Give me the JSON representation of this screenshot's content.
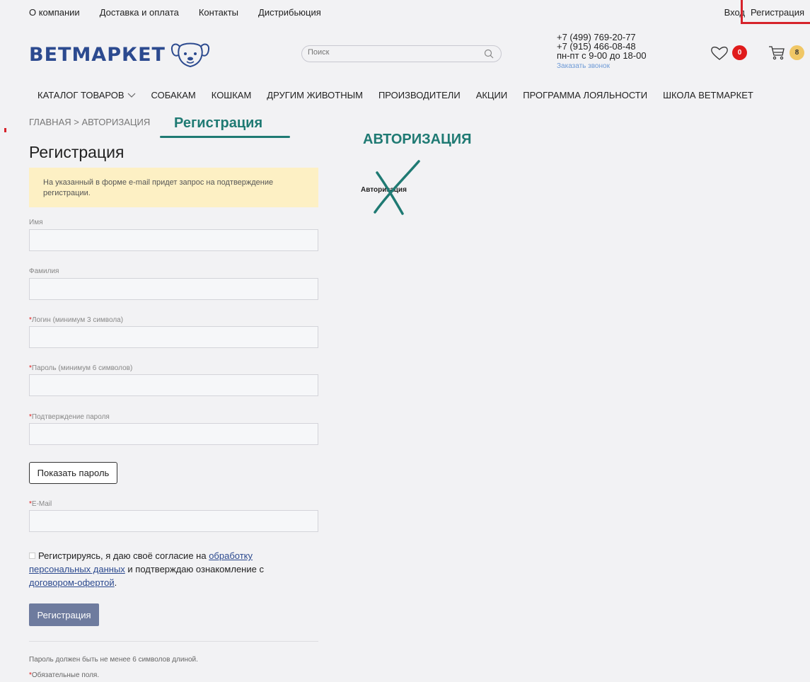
{
  "topbar": {
    "links": [
      "О компании",
      "Доставка и оплата",
      "Контакты",
      "Дистрибьюция"
    ],
    "login": "Вход",
    "register": "Регистрация"
  },
  "header": {
    "logo_text": "ВЕТМАРКЕТ",
    "search_placeholder": "Поиск",
    "phone1": "+7 (499) 769-20-77",
    "phone2": "+7 (915) 466-08-48",
    "hours": "пн-пт с 9-00 до 18-00",
    "callback": "Заказать звонок",
    "favorites_count": "0",
    "cart_count": "8"
  },
  "nav": {
    "items": [
      "КАТАЛОГ ТОВАРОВ",
      "СОБАКАМ",
      "КОШКАМ",
      "ДРУГИМ ЖИВОТНЫМ",
      "ПРОИЗВОДИТЕЛИ",
      "АКЦИИ",
      "ПРОГРАММА ЛОЯЛЬНОСТИ",
      "ШКОЛА ВЕТМАРКЕТ"
    ]
  },
  "breadcrumb": "ГЛАВНАЯ > АВТОРИЗАЦИЯ",
  "annotations": {
    "registration": "Регистрация",
    "authorization": "АВТОРИЗАЦИЯ",
    "auth_small": "Авторизация"
  },
  "form": {
    "title": "Регистрация",
    "notice": "На указанный в форме e-mail придет запрос на подтверждение регистрации.",
    "required_mark": "*",
    "fields": {
      "first_name": "Имя",
      "last_name": "Фамилия",
      "login": "Логин (минимум 3 символа)",
      "password": "Пароль (минимум 6 символов)",
      "confirm": "Подтверждение пароля",
      "email": "E-Mail"
    },
    "show_password": "Показать пароль",
    "consent_prefix": "Регистрируясь, я даю своё согласие на ",
    "consent_link1": "обработку персональных данных",
    "consent_middle": " и подтверждаю ознакомление с ",
    "consent_link2": "договором-офертой",
    "consent_suffix": ".",
    "submit": "Регистрация",
    "password_note": "Пароль должен быть не менее 6 символов длиной.",
    "required_note": "Обязательные поля."
  },
  "colors": {
    "brand_blue": "#2c4a8f",
    "annotation_teal": "#1f7a73",
    "highlight_red": "#d6232b",
    "notice_bg": "#fdf0c4",
    "submit_bg": "#6e7b9e"
  }
}
